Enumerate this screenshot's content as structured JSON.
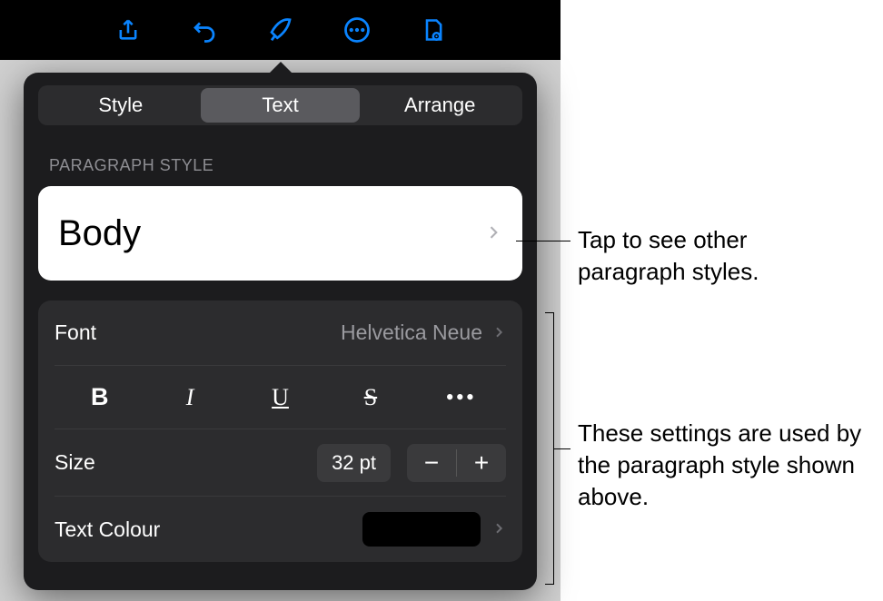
{
  "toolbar": {
    "icons": [
      "share-icon",
      "undo-icon",
      "format-brush-icon",
      "more-circle-icon",
      "document-mode-icon"
    ]
  },
  "tabs": {
    "items": [
      "Style",
      "Text",
      "Arrange"
    ],
    "active_index": 1
  },
  "section_label": "PARAGRAPH STYLE",
  "paragraph_style": {
    "name": "Body"
  },
  "font_row": {
    "label": "Font",
    "value": "Helvetica Neue"
  },
  "format_buttons": {
    "bold": "B",
    "italic": "I",
    "underline": "U",
    "strike": "S",
    "more": "•••"
  },
  "size_row": {
    "label": "Size",
    "value": "32 pt",
    "minus": "−",
    "plus": "+"
  },
  "color_row": {
    "label": "Text Colour",
    "swatch_hex": "#000000"
  },
  "annotations": {
    "a1": "Tap to see other paragraph styles.",
    "a2": "These settings are used by the paragraph style shown above."
  }
}
